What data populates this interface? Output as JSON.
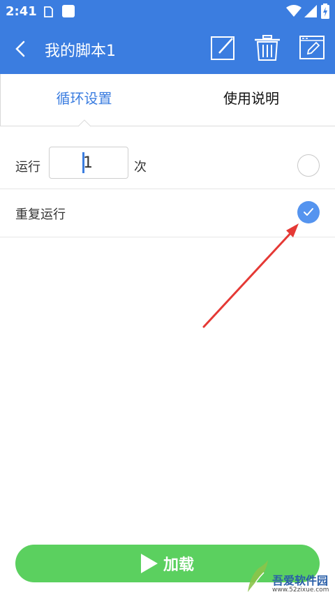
{
  "status_bar": {
    "time": "2:41"
  },
  "app_bar": {
    "title": "我的脚本1"
  },
  "tabs": [
    {
      "label": "循环设置",
      "active": true
    },
    {
      "label": "使用说明",
      "active": false
    }
  ],
  "run_row": {
    "label": "运行",
    "count_value": "1",
    "unit": "次",
    "selected": false
  },
  "repeat_row": {
    "label": "重复运行",
    "selected": true
  },
  "load_button": {
    "label": "加载"
  },
  "watermark": {
    "name": "吾爱软件园",
    "url": "www.52zixue.com"
  },
  "colors": {
    "primary": "#3b7de0",
    "radio_selected": "#5594ef",
    "load_button": "#5bd05f",
    "annotation_arrow": "#e53935"
  }
}
